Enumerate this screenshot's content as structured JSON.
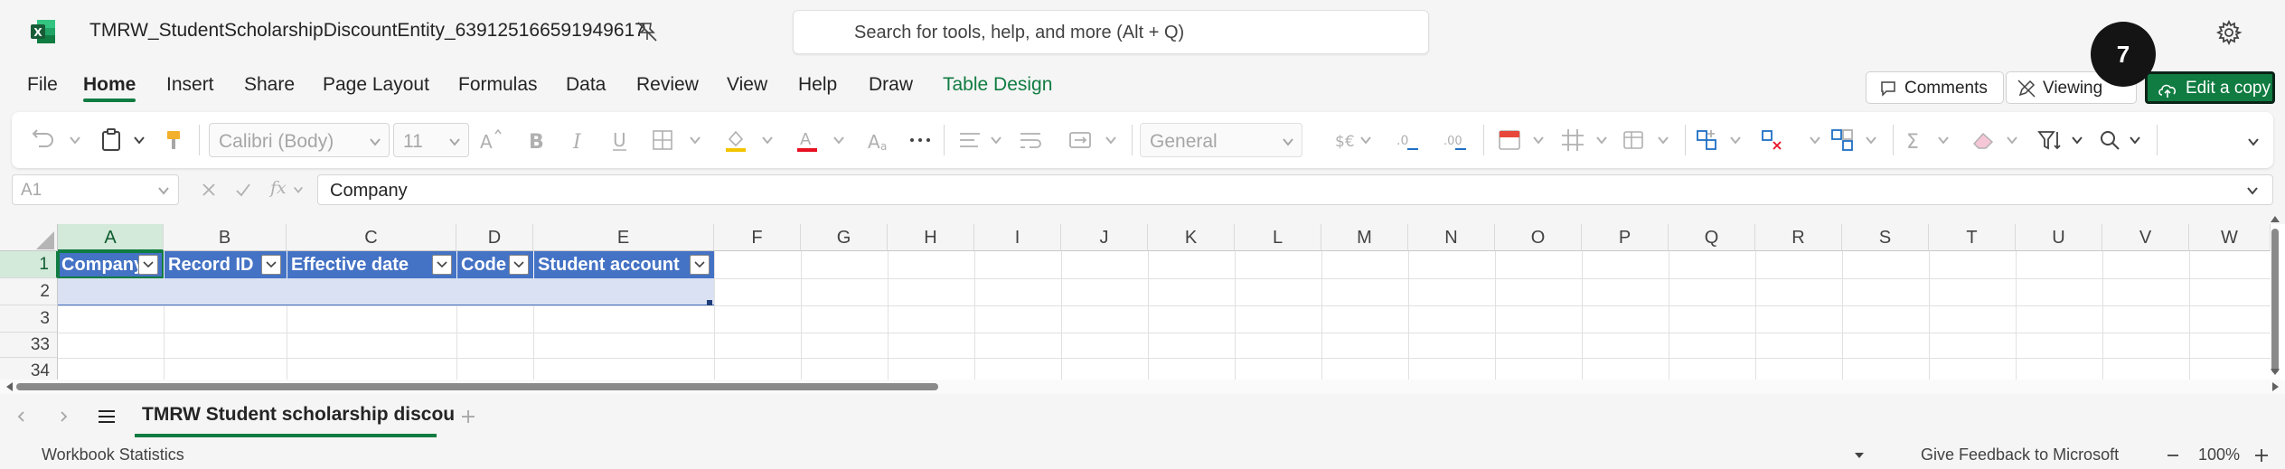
{
  "window": {
    "title": "TMRW_StudentScholarshipDiscountEntity_639125166591949617",
    "search_placeholder": "Search for tools, help, and more (Alt + Q)"
  },
  "menu": {
    "tabs": [
      "File",
      "Home",
      "Insert",
      "Share",
      "Page Layout",
      "Formulas",
      "Data",
      "Review",
      "View",
      "Help",
      "Draw",
      "Table Design"
    ],
    "active_tab": "Home",
    "comments_label": "Comments",
    "viewing_label": "Viewing",
    "edit_copy_label": "Edit a copy",
    "badge_count": "7"
  },
  "ribbon": {
    "font_name": "Calibri (Body)",
    "font_size": "11",
    "number_format": "General"
  },
  "formula_bar": {
    "name_box": "A1",
    "fx_label": "fx",
    "value": "Company"
  },
  "grid": {
    "columns": [
      "A",
      "B",
      "C",
      "D",
      "E",
      "F",
      "G",
      "H",
      "I",
      "J",
      "K",
      "L",
      "M",
      "N",
      "O",
      "P",
      "Q",
      "R",
      "S",
      "T",
      "U",
      "V",
      "W"
    ],
    "rows": [
      "1",
      "2",
      "3",
      "33",
      "34"
    ],
    "table_headers": [
      "Company",
      "Record ID",
      "Effective date",
      "Code",
      "Student account"
    ]
  },
  "sheets": {
    "active": "TMRW Student scholarship discou"
  },
  "status": {
    "left": "Workbook Statistics",
    "feedback": "Give Feedback to Microsoft",
    "zoom": "100%"
  },
  "colors": {
    "accent": "#107c41",
    "table_header": "#4472c4",
    "table_band": "#d9e1f2"
  }
}
